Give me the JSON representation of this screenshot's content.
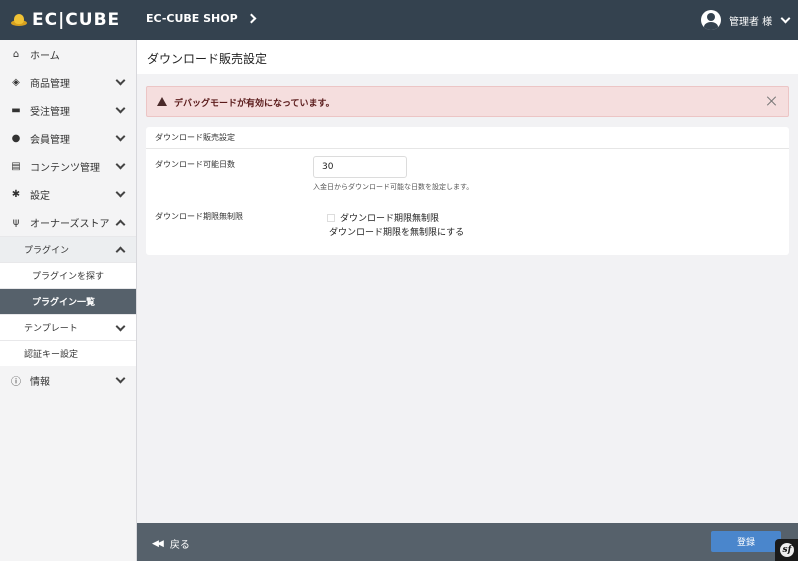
{
  "header": {
    "logo_text": "EC|CUBE",
    "shop_name": "EC-CUBE SHOP",
    "user_name": "管理者 様"
  },
  "sidebar": {
    "items": [
      {
        "label": "ホーム",
        "icon": "home-icon"
      },
      {
        "label": "商品管理",
        "icon": "cube-icon"
      },
      {
        "label": "受注管理",
        "icon": "cart-icon"
      },
      {
        "label": "会員管理",
        "icon": "users-icon"
      },
      {
        "label": "コンテンツ管理",
        "icon": "file-icon"
      },
      {
        "label": "設定",
        "icon": "gear-icon"
      },
      {
        "label": "オーナーズストア",
        "icon": "plug-icon"
      }
    ],
    "owners": {
      "plugin_group": "プラグイン",
      "plugin_find": "プラグインを探す",
      "plugin_list": "プラグイン一覧",
      "template": "テンプレート",
      "auth_key": "認証キー設定"
    },
    "info": {
      "label": "情報",
      "icon": "info-icon"
    }
  },
  "page": {
    "title": "ダウンロード販売設定"
  },
  "alert": {
    "text": "デバッグモードが有効になっています。"
  },
  "card": {
    "header": "ダウンロード販売設定",
    "days_label": "ダウンロード可能日数",
    "days_value": "30",
    "days_help": "入金日からダウンロード可能な日数を設定します。",
    "unlimited_label": "ダウンロード期限無制限",
    "unlimited_checkbox": "ダウンロード期限無制限",
    "unlimited_checked": false,
    "unlimited_help": "ダウンロード期限を無制限にする"
  },
  "footer": {
    "back_label": "戻る",
    "submit_label": "登録"
  },
  "colors": {
    "header_bg": "#34424f",
    "footer_bg": "#56616b",
    "alert_bg": "#f5dede",
    "primary_button": "#4a86cc"
  }
}
